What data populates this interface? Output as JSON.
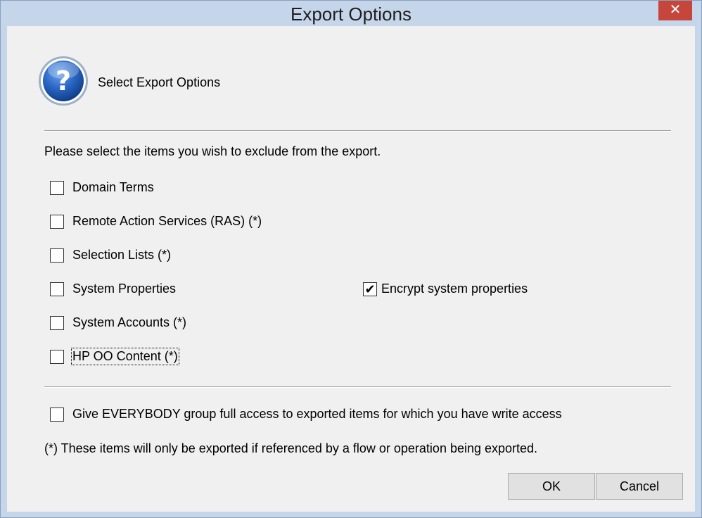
{
  "window": {
    "title": "Export Options",
    "close_glyph": "✕"
  },
  "header": {
    "icon": "question-icon",
    "text": "Select Export Options"
  },
  "instruction": "Please select the items you wish to exclude from the export.",
  "checkboxes": [
    {
      "label": "Domain Terms",
      "checked": false
    },
    {
      "label": "Remote Action Services (RAS)  (*)",
      "checked": false
    },
    {
      "label": "Selection Lists  (*)",
      "checked": false
    },
    {
      "label": "System Properties",
      "checked": false
    },
    {
      "label": "System Accounts  (*)",
      "checked": false
    },
    {
      "label": "HP OO Content  (*)",
      "checked": false,
      "focused": true
    }
  ],
  "encrypt": {
    "label": "Encrypt system properties",
    "checked": true
  },
  "everybody": {
    "label": "Give EVERYBODY group full access to exported items for which you have write access",
    "checked": false
  },
  "footnote": "(*) These items will only be exported if referenced by a flow or operation being exported.",
  "buttons": {
    "ok": "OK",
    "cancel": "Cancel"
  },
  "colors": {
    "titlebar": "#c6d6ea",
    "close": "#c7463c",
    "icon_blue": "#1f5bb5"
  }
}
